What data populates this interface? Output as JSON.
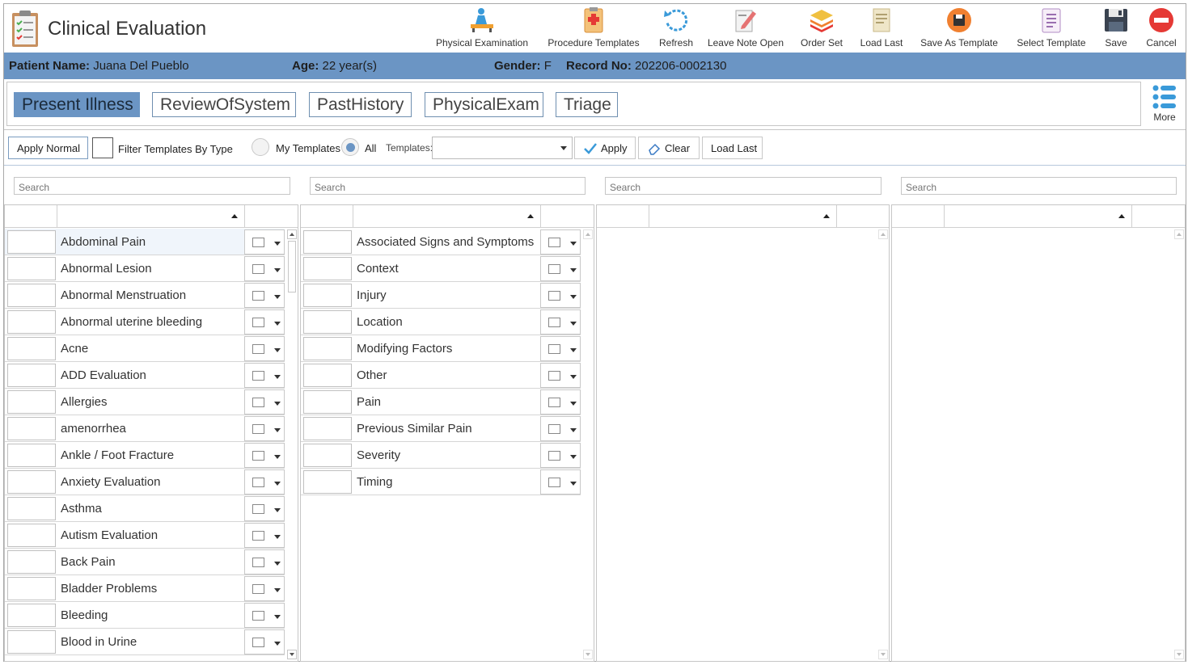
{
  "app": {
    "title": "Clinical Evaluation",
    "icon": "clipboard-checklist-icon"
  },
  "toolbar": [
    {
      "label": "Physical Examination",
      "icon": "physical-exam-icon"
    },
    {
      "label": "Procedure Templates",
      "icon": "procedure-templates-icon"
    },
    {
      "label": "Refresh",
      "icon": "refresh-icon"
    },
    {
      "label": "Leave Note Open",
      "icon": "leave-note-open-icon"
    },
    {
      "label": "Order Set",
      "icon": "order-set-icon"
    },
    {
      "label": "Load Last",
      "icon": "load-last-icon"
    },
    {
      "label": "Save As Template",
      "icon": "save-as-template-icon"
    },
    {
      "label": "Select Template",
      "icon": "select-template-icon"
    },
    {
      "label": "Save",
      "icon": "save-icon"
    },
    {
      "label": "Cancel",
      "icon": "cancel-icon"
    }
  ],
  "patient": {
    "name_label": "Patient Name:",
    "name": "Juana Del Pueblo",
    "age_label": "Age:",
    "age": "22 year(s)",
    "gender_label": "Gender:",
    "gender": "F",
    "record_label": "Record No:",
    "record": "202206-0002130"
  },
  "tabs": [
    {
      "label": "Present Illness",
      "active": true
    },
    {
      "label": "ReviewOfSystem",
      "active": false
    },
    {
      "label": "PastHistory",
      "active": false
    },
    {
      "label": "PhysicalExam",
      "active": false
    },
    {
      "label": "Triage",
      "active": false
    }
  ],
  "more": {
    "label": "More",
    "icon": "list-menu-icon"
  },
  "filter": {
    "apply_normal": "Apply Normal",
    "filter_by_type": "Filter Templates By Type",
    "my_templates": "My Templates",
    "all": "All",
    "selected_scope": "All",
    "templates_label": "Templates:",
    "templates_value": "",
    "apply": "Apply",
    "clear": "Clear",
    "load_last": "Load Last"
  },
  "search_placeholder": "Search",
  "panels": [
    {
      "items": [
        "Abdominal Pain",
        "Abnormal Lesion",
        "Abnormal Menstruation",
        "Abnormal uterine bleeding",
        "Acne",
        "ADD Evaluation",
        "Allergies",
        "amenorrhea",
        "Ankle / Foot Fracture",
        "Anxiety Evaluation",
        "Asthma",
        "Autism Evaluation",
        "Back Pain",
        "Bladder Problems",
        "Bleeding",
        "Blood in Urine"
      ],
      "selected_index": 0
    },
    {
      "items": [
        "Associated Signs and Symptoms",
        "Context",
        "Injury",
        "Location",
        "Modifying Factors",
        "Other",
        "Pain",
        "Previous Similar Pain",
        "Severity",
        "Timing"
      ],
      "selected_index": -1
    },
    {
      "items": [],
      "selected_index": -1
    },
    {
      "items": [],
      "selected_index": -1
    }
  ],
  "colors": {
    "accent": "#6b95c4",
    "border": "#c6c6c6"
  }
}
